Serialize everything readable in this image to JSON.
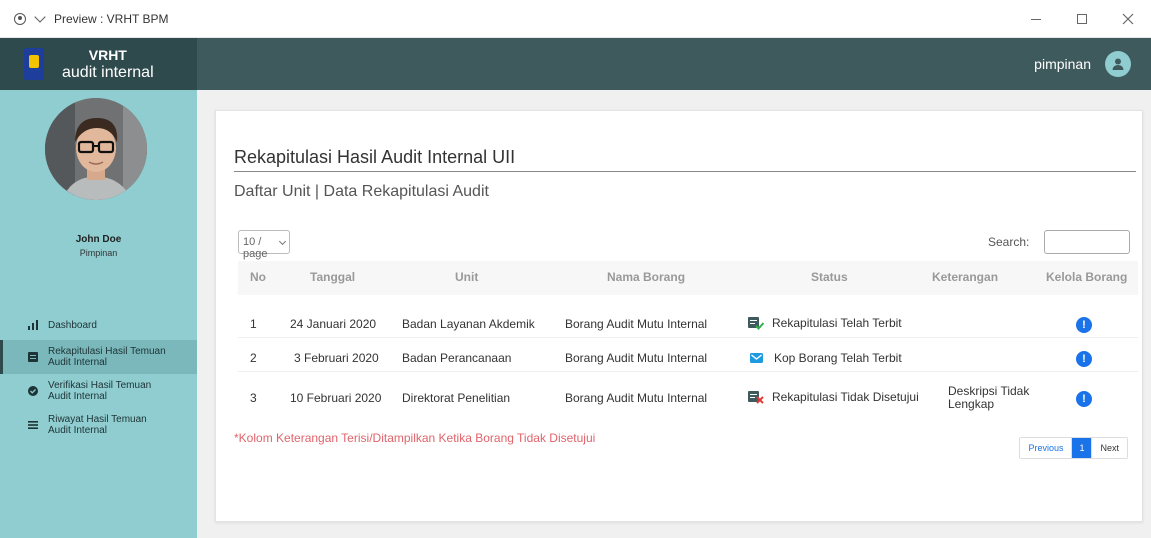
{
  "window": {
    "title": "Preview : VRHT BPM"
  },
  "brand": {
    "title": "VRHT",
    "subtitle": "audit internal"
  },
  "topbar": {
    "user": "pimpinan"
  },
  "profile": {
    "name": "John Doe",
    "role": "Pimpinan"
  },
  "sidebar": {
    "items": [
      {
        "label": "Dashboard",
        "icon": "bar-chart-icon"
      },
      {
        "label": "Rekapitulasi Hasil Temuan Audit Internal",
        "icon": "list-icon"
      },
      {
        "label": "Verifikasi Hasil Temuan Audit Internal",
        "icon": "check-circle-icon"
      },
      {
        "label": "Riwayat Hasil Temuan Audit Internal",
        "icon": "menu-icon"
      }
    ]
  },
  "card": {
    "title": "Rekapitulasi Hasil Audit Internal UII",
    "subtitle": "Daftar Unit | Data Rekapitulasi Audit",
    "page_size": "10 / page",
    "search_label": "Search:"
  },
  "table": {
    "headers": [
      "No",
      "Tanggal",
      "Unit",
      "Nama Borang",
      "Status",
      "Keterangan",
      "Kelola Borang"
    ],
    "rows": [
      {
        "no": "1",
        "tanggal": "24 Januari 2020",
        "unit": "Badan Layanan Akdemik",
        "borang": "Borang Audit Mutu Internal",
        "status": "Rekapitulasi Telah Terbit",
        "status_icon": "doc-check-icon",
        "keterangan_1": "",
        "keterangan_2": ""
      },
      {
        "no": "2",
        "tanggal": "3 Februari 2020",
        "unit": "Badan Perancanaan",
        "borang": "Borang Audit Mutu Internal",
        "status": "Kop Borang Telah Terbit",
        "status_icon": "mail-icon",
        "keterangan_1": "",
        "keterangan_2": ""
      },
      {
        "no": "3",
        "tanggal": "10 Februari 2020",
        "unit": "Direktorat Penelitian",
        "borang": "Borang Audit Mutu Internal",
        "status": "Rekapitulasi Tidak Disetujui",
        "status_icon": "doc-reject-icon",
        "keterangan_1": "Deskripsi Tidak",
        "keterangan_2": "Lengkap"
      }
    ],
    "action_icon": "info-icon",
    "action_glyph": "!"
  },
  "note": "*Kolom Keterangan Terisi/Ditampilkan Ketika Borang Tidak Disetujui",
  "pagination": {
    "previous": "Previous",
    "current": "1",
    "next": "Next"
  },
  "colors": {
    "sidebar": "#8fcdd0",
    "topbar": "#3f5a5c",
    "brand": "#2f4a4d",
    "accent": "#1a73e8",
    "note": "#e0646b"
  }
}
